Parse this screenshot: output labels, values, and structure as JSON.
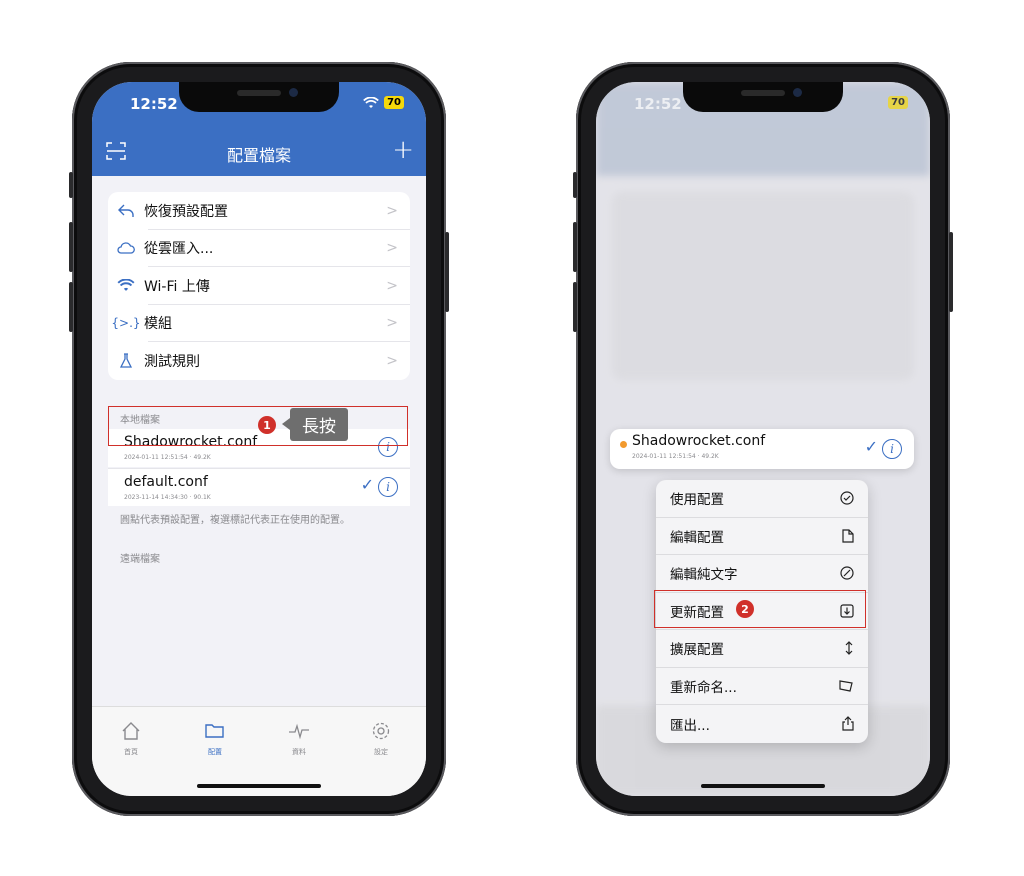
{
  "left": {
    "status": {
      "time": "12:52",
      "battery": "70"
    },
    "nav": {
      "title": "配置檔案",
      "add": "+"
    },
    "menu_items": [
      {
        "label": "恢復預設配置",
        "icon": "undo-icon"
      },
      {
        "label": "從雲匯入...",
        "icon": "cloud-icon"
      },
      {
        "label": "Wi-Fi 上傳",
        "icon": "wifi-icon"
      },
      {
        "label": "模組",
        "icon": "module-icon"
      },
      {
        "label": "測試規則",
        "icon": "test-icon"
      }
    ],
    "chevron": ">",
    "local_section": "本地檔案",
    "files": [
      {
        "name": "Shadowrocket.conf",
        "meta": "2024-01-11 12:51:54 · 49.2K"
      },
      {
        "name": "default.conf",
        "meta": "2023-11-14 14:34:30 · 90.1K"
      }
    ],
    "hint": "圓點代表預設配置，複選標記代表正在使用的配置。",
    "remote_section": "遠端檔案",
    "tabs": [
      {
        "label": "首頁",
        "icon": "home-icon"
      },
      {
        "label": "配置",
        "icon": "folder-icon"
      },
      {
        "label": "資料",
        "icon": "pulse-icon"
      },
      {
        "label": "設定",
        "icon": "gear-icon"
      }
    ],
    "step_badge": "1",
    "tooltip": "長按"
  },
  "right": {
    "status": {
      "time": "12:52",
      "battery": "70"
    },
    "preview": {
      "name": "Shadowrocket.conf",
      "meta": "2024-01-11 12:51:54 · 49.2K"
    },
    "context_menu": [
      {
        "label": "使用配置",
        "icon": "check-circle-icon",
        "glyph": "⊘"
      },
      {
        "label": "編輯配置",
        "icon": "document-icon",
        "glyph": "🗋"
      },
      {
        "label": "編輯純文字",
        "icon": "slash-circle-icon",
        "glyph": "⊘"
      },
      {
        "label": "更新配置",
        "icon": "download-icon",
        "glyph": "⊻"
      },
      {
        "label": "擴展配置",
        "icon": "expand-arrows-icon",
        "glyph": "↕"
      },
      {
        "label": "重新命名...",
        "icon": "rename-icon",
        "glyph": "⏢"
      },
      {
        "label": "匯出...",
        "icon": "share-icon",
        "glyph": "⇪"
      }
    ],
    "step_badge": "2"
  },
  "colors": {
    "accent": "#3b6fc3",
    "highlight": "#d0302a",
    "dot": "#f29a2e"
  }
}
